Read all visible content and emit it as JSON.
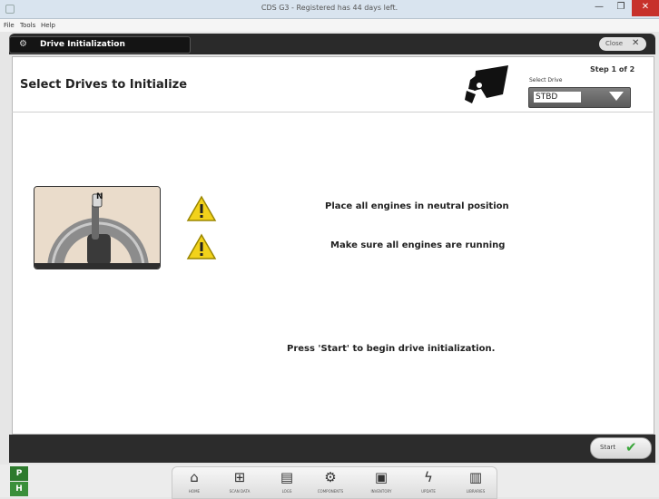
{
  "window": {
    "title": "CDS G3 - Registered has 44 days left.",
    "minimize_glyph": "—",
    "maximize_glyph": "❐",
    "close_glyph": "✕"
  },
  "menu": [
    "File",
    "Tools",
    "Help"
  ],
  "header": {
    "tab_label": "Drive Initialization",
    "tab_icon": "gear-icon",
    "close_label": "Close",
    "close_glyph": "✕"
  },
  "page": {
    "title": "Select Drives to Initialize",
    "step": "Step 1 of 2",
    "select_label": "Select Drive",
    "select_value": "STBD"
  },
  "lever_label": "N",
  "instructions": [
    "Place all engines in neutral position",
    "Make sure all engines are running"
  ],
  "prompt": "Press 'Start' to begin drive initialization.",
  "footer": {
    "start_label": "Start",
    "start_glyph": "✔"
  },
  "side_badges": [
    "P",
    "H"
  ],
  "nav": [
    {
      "label": "HOME",
      "icon": "home-icon",
      "glyph": "⌂"
    },
    {
      "label": "SCAN DATA",
      "icon": "sitemap-icon",
      "glyph": "⊞"
    },
    {
      "label": "LOGS",
      "icon": "clipboard-icon",
      "glyph": "▤"
    },
    {
      "label": "COMPONENTS",
      "icon": "engine-icon",
      "glyph": "⚙"
    },
    {
      "label": "INVENTORY",
      "icon": "monitor-icon",
      "glyph": "▣"
    },
    {
      "label": "UPDATE",
      "icon": "lightning-icon",
      "glyph": "ϟ"
    },
    {
      "label": "LIBRARIES",
      "icon": "book-icon",
      "glyph": "▥"
    }
  ],
  "colors": {
    "close_red": "#c7312b",
    "dark_bar": "#2a2a2a",
    "warning_yellow": "#f2d21b",
    "check_green": "#3aa63a",
    "badge_green": "#2d7a2d"
  }
}
